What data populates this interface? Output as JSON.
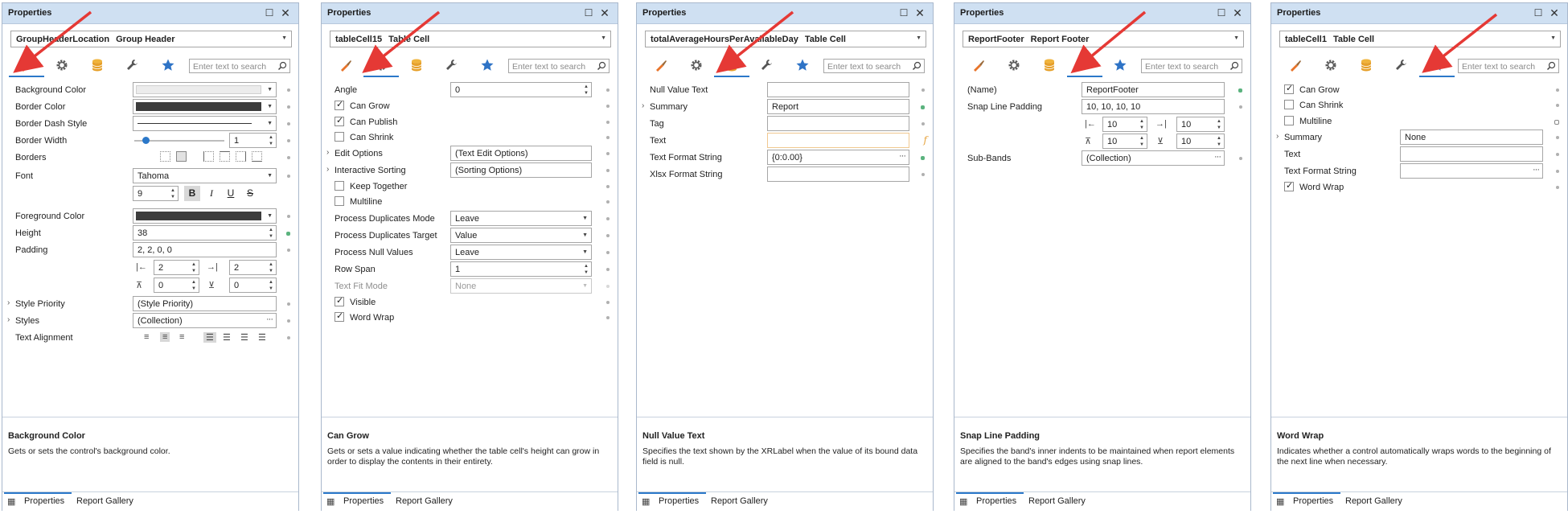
{
  "colors": {
    "accent": "#2b78c9",
    "titlebar": "#cfe0f2",
    "arrow": "#e53935",
    "border_dark": "#3c3c3c"
  },
  "common": {
    "window_title": "Properties",
    "search_placeholder": "Enter text to search",
    "footer_tabs": [
      "Properties",
      "Report Gallery"
    ],
    "tabs": [
      "brush-icon",
      "gear-icon",
      "database-icon",
      "wrench-icon",
      "star-icon"
    ]
  },
  "panels": [
    {
      "object_name": "GroupHeaderLocation",
      "object_type": "Group Header",
      "active_tab": 0,
      "rows": [
        {
          "label": "Background Color"
        },
        {
          "label": "Border Color"
        },
        {
          "label": "Border Dash Style"
        },
        {
          "label": "Border Width",
          "value": "1"
        },
        {
          "label": "Borders"
        },
        {
          "label": "Font",
          "value": "Tahoma",
          "size": "9",
          "styles": [
            "B",
            "I",
            "U",
            "S"
          ]
        },
        {
          "label": "Foreground Color"
        },
        {
          "label": "Height",
          "value": "38"
        },
        {
          "label": "Padding",
          "value": "2, 2, 0, 0",
          "left": "2",
          "right": "2",
          "top": "0",
          "bottom": "0"
        },
        {
          "label": "Style Priority",
          "value": "(Style Priority)"
        },
        {
          "label": "Styles",
          "value": "(Collection)"
        },
        {
          "label": "Text Alignment"
        }
      ],
      "desc_title": "Background Color",
      "desc_text": "Gets or sets the control's background color."
    },
    {
      "object_name": "tableCell15",
      "object_type": "Table Cell",
      "active_tab": 1,
      "rows": [
        {
          "label": "Angle",
          "value": "0"
        },
        {
          "label": "Can Grow",
          "checked": true
        },
        {
          "label": "Can Publish",
          "checked": true
        },
        {
          "label": "Can Shrink",
          "checked": false
        },
        {
          "label": "Edit Options",
          "value": "(Text Edit Options)"
        },
        {
          "label": "Interactive Sorting",
          "value": "(Sorting Options)"
        },
        {
          "label": "Keep Together",
          "checked": false
        },
        {
          "label": "Multiline",
          "checked": false
        },
        {
          "label": "Process Duplicates Mode",
          "value": "Leave"
        },
        {
          "label": "Process Duplicates Target",
          "value": "Value"
        },
        {
          "label": "Process Null Values",
          "value": "Leave"
        },
        {
          "label": "Row Span",
          "value": "1"
        },
        {
          "label": "Text Fit Mode",
          "value": "None"
        },
        {
          "label": "Visible",
          "checked": true
        },
        {
          "label": "Word Wrap",
          "checked": true
        }
      ],
      "desc_title": "Can Grow",
      "desc_text": "Gets or sets a value indicating whether the table cell's height can grow in order to display the contents in their entirety."
    },
    {
      "object_name": "totalAverageHoursPerAvailableDay",
      "object_type": "Table Cell",
      "active_tab": 2,
      "rows": [
        {
          "label": "Null Value Text",
          "value": ""
        },
        {
          "label": "Summary",
          "value": "Report"
        },
        {
          "label": "Tag",
          "value": ""
        },
        {
          "label": "Text",
          "value": ""
        },
        {
          "label": "Text Format String",
          "value": "{0:0.00}"
        },
        {
          "label": "Xlsx Format String",
          "value": ""
        }
      ],
      "desc_title": "Null Value Text",
      "desc_text": "Specifies the text shown by the XRLabel when the value of its bound data field is null."
    },
    {
      "object_name": "ReportFooter",
      "object_type": "Report Footer",
      "active_tab": 3,
      "rows": [
        {
          "label": "(Name)",
          "value": "ReportFooter"
        },
        {
          "label": "Snap Line Padding",
          "value": "10, 10, 10, 10",
          "left": "10",
          "right": "10",
          "top": "10",
          "bottom": "10"
        },
        {
          "label": "Sub-Bands",
          "value": "(Collection)"
        }
      ],
      "desc_title": "Snap Line Padding",
      "desc_text": "Specifies the band's inner indents to be maintained when report elements are aligned to the band's edges using snap lines."
    },
    {
      "object_name": "tableCell1",
      "object_type": "Table Cell",
      "active_tab": 4,
      "rows": [
        {
          "label": "Can Grow",
          "checked": true
        },
        {
          "label": "Can Shrink",
          "checked": false
        },
        {
          "label": "Multiline",
          "checked": false
        },
        {
          "label": "Summary",
          "value": "None"
        },
        {
          "label": "Text",
          "value": ""
        },
        {
          "label": "Text Format String",
          "value": ""
        },
        {
          "label": "Word Wrap",
          "checked": true
        }
      ],
      "desc_title": "Word Wrap",
      "desc_text": "Indicates whether a control automatically wraps words to the beginning of the next line when necessary."
    }
  ]
}
